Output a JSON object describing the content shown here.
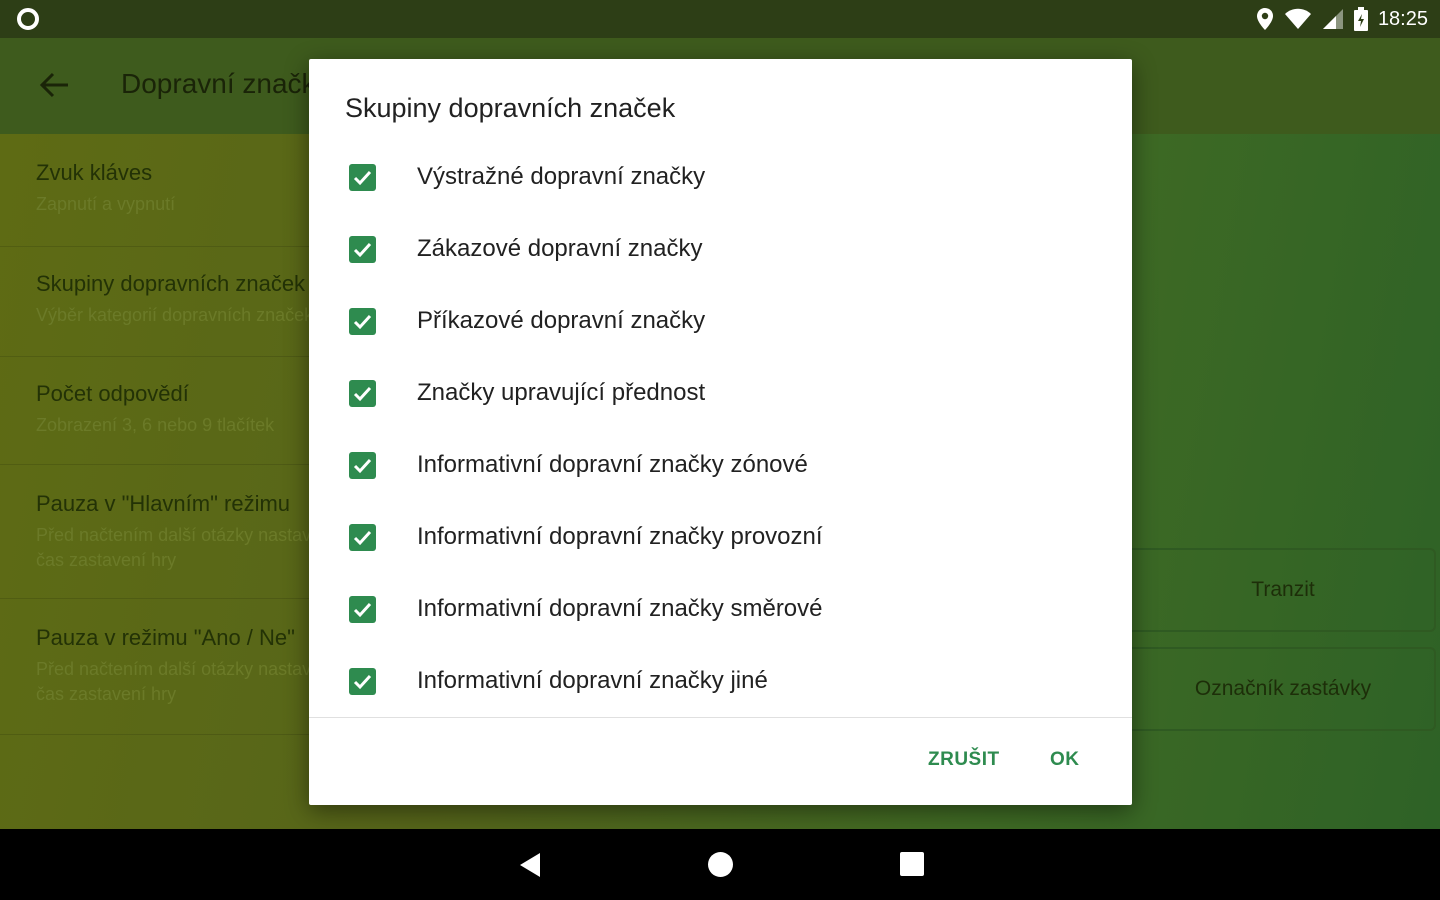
{
  "status_bar": {
    "time": "18:25"
  },
  "app_bar": {
    "title": "Dopravní značky"
  },
  "settings": [
    {
      "title": "Zvuk kláves",
      "subtitle": "Zapnutí a vypnutí"
    },
    {
      "title": "Skupiny dopravních značek",
      "subtitle": "Výběr kategorií dopravních značek"
    },
    {
      "title": "Počet odpovědí",
      "subtitle": "Zobrazení 3, 6 nebo 9 tlačítek"
    },
    {
      "title": "Pauza v \"Hlavním\" režimu",
      "subtitle": "Před načtením další otázky nastavení",
      "subtitle2": "čas zastavení hry"
    },
    {
      "title": "Pauza v režimu \"Ano / Ne\"",
      "subtitle": "Před načtením další otázky nastavení",
      "subtitle2": "čas zastavení hry"
    }
  ],
  "side_cards": {
    "card1": "Tranzit",
    "card2": "Označník zastávky"
  },
  "dialog": {
    "title": "Skupiny dopravních značek",
    "options": [
      {
        "label": "Výstražné dopravní značky",
        "checked": true
      },
      {
        "label": "Zákazové dopravní značky",
        "checked": true
      },
      {
        "label": "Příkazové dopravní značky",
        "checked": true
      },
      {
        "label": "Značky upravující přednost",
        "checked": true
      },
      {
        "label": "Informativní dopravní značky zónové",
        "checked": true
      },
      {
        "label": "Informativní dopravní značky provozní",
        "checked": true
      },
      {
        "label": "Informativní dopravní značky směrové",
        "checked": true
      },
      {
        "label": "Informativní dopravní značky jiné",
        "checked": true
      }
    ],
    "cancel_label": "ZRUŠIT",
    "ok_label": "OK"
  },
  "colors": {
    "accent": "#2e8b4f",
    "app_bar": "#3e5b1d",
    "status_bar": "#2d3e16"
  },
  "icons": {
    "status_left": "circle-icon",
    "location": "location-icon",
    "wifi": "wifi-icon",
    "signal": "signal-icon",
    "battery": "battery-icon",
    "back": "back-arrow-icon",
    "check": "checkmark-icon"
  }
}
